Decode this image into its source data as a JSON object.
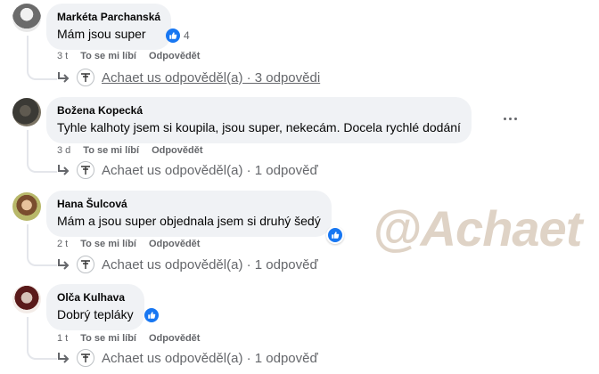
{
  "comments": [
    {
      "author": "Markéta Parchanská",
      "text": "Mám jsou super",
      "reaction_count": "4",
      "time": "3 t",
      "like_label": "To se mi líbí",
      "reply_label": "Odpovědět",
      "replies_summary": "Achaet us odpověděl(a) · 3 odpovědi"
    },
    {
      "author": "Božena Kopecká",
      "text": "Tyhle kalhoty jsem si koupila, jsou super, nekecám. Docela rychlé dodání",
      "time": "3 d",
      "like_label": "To se mi líbí",
      "reply_label": "Odpovědět",
      "replies_summary": "Achaet us odpověděl(a) · 1 odpověď"
    },
    {
      "author": "Hana Šulcová",
      "text": "Mám a jsou super objednala jsem si druhý šedý",
      "time": "2 t",
      "like_label": "To se mi líbí",
      "reply_label": "Odpovědět",
      "replies_summary": "Achaet us odpověděl(a) · 1 odpověď"
    },
    {
      "author": "Olča Kulhava",
      "text": "Dobrý tepláky",
      "time": "1 t",
      "like_label": "To se mi líbí",
      "reply_label": "Odpovědět",
      "replies_summary": "Achaet us odpověděl(a) · 1 odpověď"
    }
  ],
  "watermark": "@Achaet",
  "colors": {
    "like_blue": "#1877f2",
    "bubble": "#f0f2f5",
    "meta": "#65676b"
  }
}
